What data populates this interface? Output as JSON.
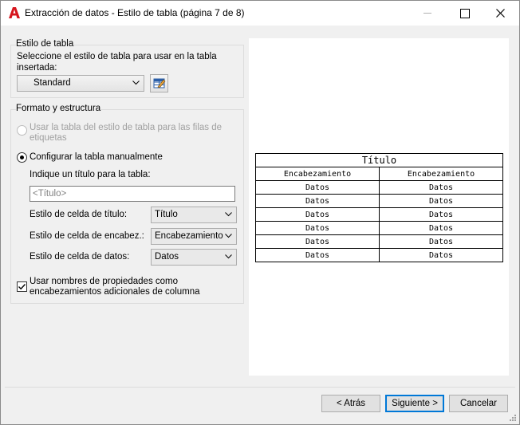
{
  "window": {
    "title": "Extracción de datos - Estilo de tabla (página 7 de 8)",
    "accent_color": "#d6151d"
  },
  "table_style_group": {
    "title": "Estilo de tabla",
    "instruction": "Seleccione el estilo de tabla para usar en la tabla insertada:",
    "style_value": "Standard"
  },
  "format_group": {
    "title": "Formato y estructura",
    "radio_from_style": "Usar la tabla del estilo de tabla para las filas de etiquetas",
    "radio_manual": "Configurar la tabla manualmente",
    "title_prompt": "Indique un título para la tabla:",
    "title_placeholder": "<Título>",
    "title_cell_label": "Estilo de celda de título:",
    "title_cell_value": "Título",
    "header_cell_label": "Estilo de celda de encabez.:",
    "header_cell_value": "Encabezamiento",
    "data_cell_label": "Estilo de celda de datos:",
    "data_cell_value": "Datos",
    "checkbox_label": "Usar nombres de propiedades como encabezamientos adicionales de columna"
  },
  "preview": {
    "title": "Título",
    "headers": [
      "Encabezamiento",
      "Encabezamiento"
    ],
    "rows": [
      [
        "Datos",
        "Datos"
      ],
      [
        "Datos",
        "Datos"
      ],
      [
        "Datos",
        "Datos"
      ],
      [
        "Datos",
        "Datos"
      ],
      [
        "Datos",
        "Datos"
      ],
      [
        "Datos",
        "Datos"
      ]
    ]
  },
  "buttons": {
    "back": "< Atrás",
    "next": "Siguiente >",
    "cancel": "Cancelar"
  }
}
